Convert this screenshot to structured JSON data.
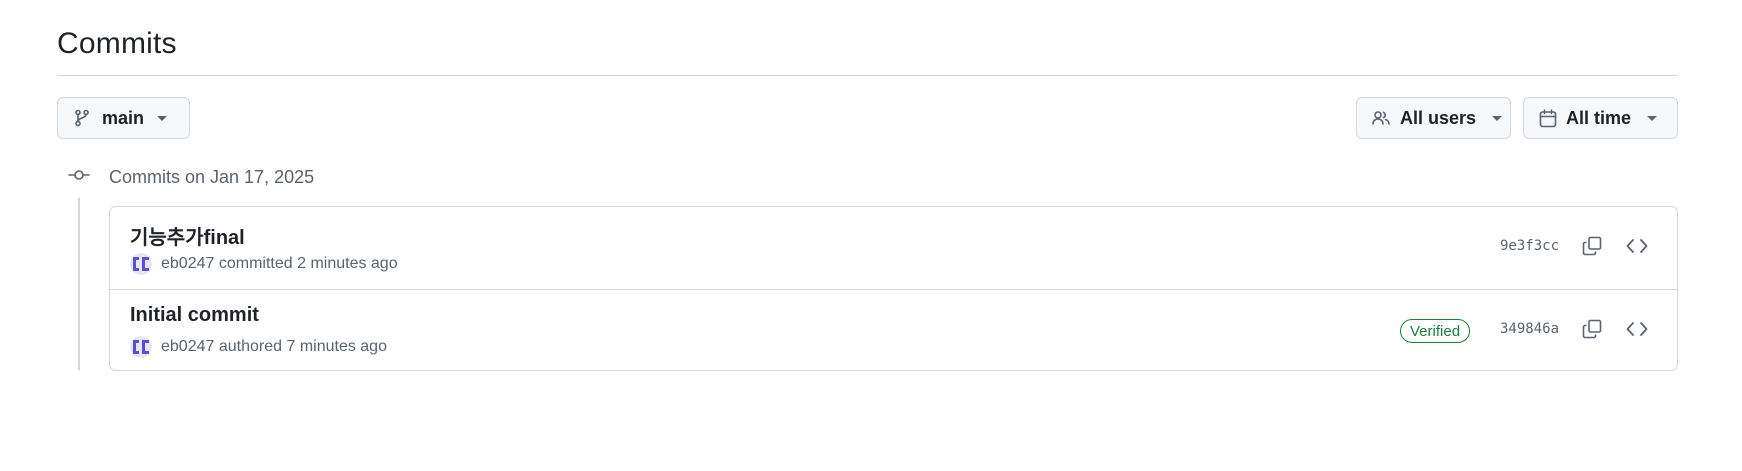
{
  "page": {
    "title": "Commits"
  },
  "filters": {
    "branch_label": "main",
    "users_label": "All users",
    "time_label": "All time"
  },
  "groups": [
    {
      "label": "Commits on Jan 17, 2025",
      "commits": [
        {
          "message": "기능추가final",
          "author": "eb0247",
          "action": "committed",
          "time": "2 minutes ago",
          "verified": "",
          "sha": "9e3f3cc"
        },
        {
          "message": "Initial commit",
          "author": "eb0247",
          "action": "authored",
          "time": "7 minutes ago",
          "verified": "Verified",
          "sha": "349846a"
        }
      ]
    }
  ],
  "icons": {
    "branch": "git-branch-icon",
    "users": "people-icon",
    "time": "calendar-icon",
    "group": "git-commit-icon",
    "copy": "copy-icon",
    "browse": "code-icon"
  },
  "colors": {
    "text": "#1f2328",
    "muted": "#59636e",
    "border": "#d1d9e0",
    "button_bg": "#f6f8fa",
    "verified": "#1a7f37",
    "avatar": "#5a4fcf"
  }
}
